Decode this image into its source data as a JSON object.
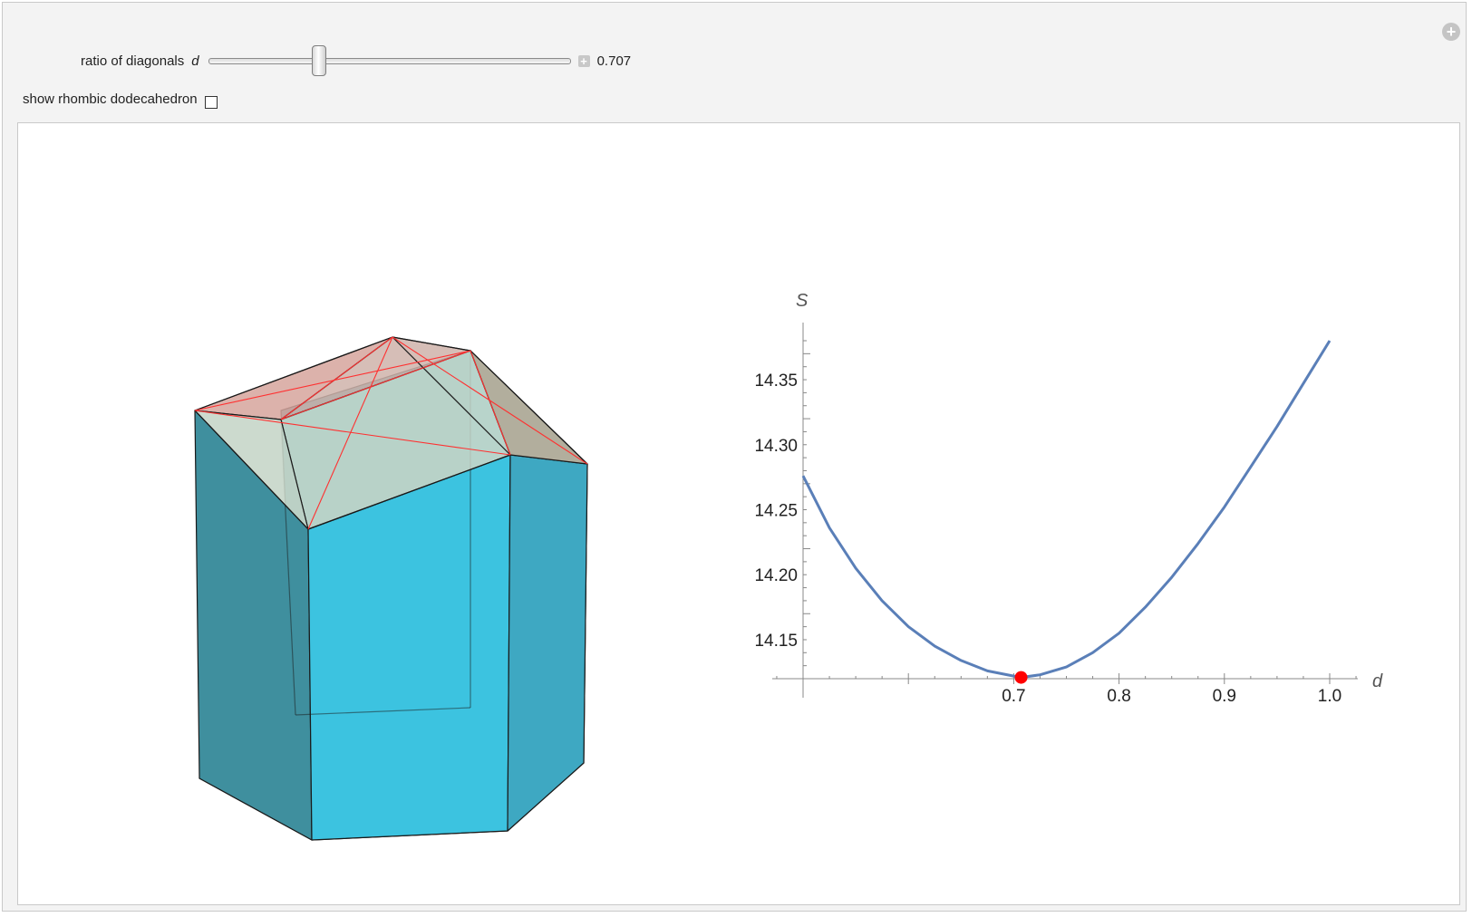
{
  "controls": {
    "slider": {
      "label": "ratio of diagonals",
      "variable": "d",
      "value_text": "0.707",
      "value": 0.707,
      "min": 0.5,
      "max": 1.0
    },
    "checkbox": {
      "label": "show rhombic dodecahedron",
      "checked": false
    }
  },
  "colors": {
    "curve": "#5a7fb8",
    "marker": "#ff0000",
    "prism_side": "#3bbfe0",
    "prism_dark": "#3f8f9e",
    "top_face": "#c4d8cc",
    "top_pink": "#d9aba2",
    "diagonal": "#ff3333"
  },
  "chart_data": {
    "type": "line",
    "xlabel": "d",
    "ylabel": "S",
    "xlim": [
      0.5,
      1.03
    ],
    "ylim": [
      14.12,
      14.38
    ],
    "x_ticks": [
      "0.7",
      "0.8",
      "0.9",
      "1.0"
    ],
    "y_ticks": [
      "14.15",
      "14.20",
      "14.25",
      "14.30",
      "14.35"
    ],
    "series": [
      {
        "x": [
          0.5,
          0.525,
          0.55,
          0.575,
          0.6,
          0.625,
          0.65,
          0.675,
          0.7,
          0.707,
          0.725,
          0.75,
          0.775,
          0.8,
          0.825,
          0.85,
          0.875,
          0.9,
          0.925,
          0.95,
          0.975,
          1.0
        ],
        "values": [
          14.276,
          14.236,
          14.205,
          14.18,
          14.16,
          14.145,
          14.134,
          14.126,
          14.122,
          14.121,
          14.123,
          14.129,
          14.14,
          14.155,
          14.175,
          14.198,
          14.224,
          14.252,
          14.283,
          14.314,
          14.347,
          14.38
        ]
      }
    ],
    "marker": {
      "x": 0.707,
      "y": 14.121
    }
  }
}
